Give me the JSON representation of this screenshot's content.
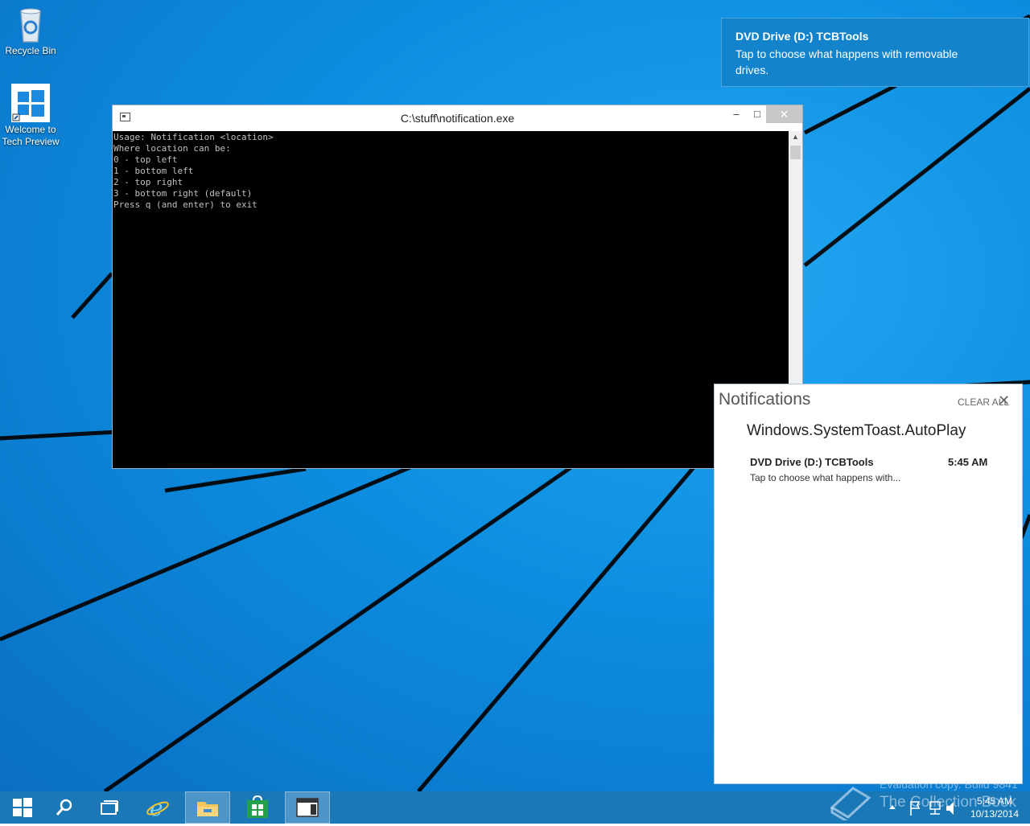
{
  "desktop": {
    "icons": [
      {
        "label": "Recycle Bin"
      },
      {
        "label": "Welcome to Tech Preview"
      }
    ]
  },
  "console": {
    "title": "C:\\stuff\\notification.exe",
    "buttons": {
      "minimize": "–",
      "maximize": "□",
      "close": "✕"
    },
    "lines": [
      "Usage: Notification <location>",
      "Where location can be:",
      "0 - top left",
      "1 - bottom left",
      "2 - top right",
      "3 - bottom right (default)",
      "Press q (and enter) to exit"
    ]
  },
  "toast": {
    "title": "DVD Drive (D:) TCBTools",
    "body": "Tap to choose what happens with removable drives."
  },
  "notification_center": {
    "title": "Notifications",
    "clear_all": "CLEAR ALL",
    "close_glyph": "✕",
    "group": "Windows.SystemToast.AutoPlay",
    "item": {
      "title": "DVD Drive (D:) TCBTools",
      "time": "5:45 AM",
      "body": "Tap to choose what happens with..."
    }
  },
  "watermark": {
    "line1": "Evaluation copy. Build 9841",
    "line2": "The Collection Book"
  },
  "taskbar": {
    "clock_time": "5:45 AM",
    "clock_date": "10/13/2014",
    "icons": [
      "windows-start-icon",
      "search-icon",
      "task-view-icon",
      "internet-explorer-icon",
      "file-explorer-icon",
      "store-icon",
      "console-window-icon"
    ]
  },
  "colors": {
    "accent": "#1383cb",
    "taskbar": "#1a78b7",
    "desktop": "#0d8ee0"
  }
}
